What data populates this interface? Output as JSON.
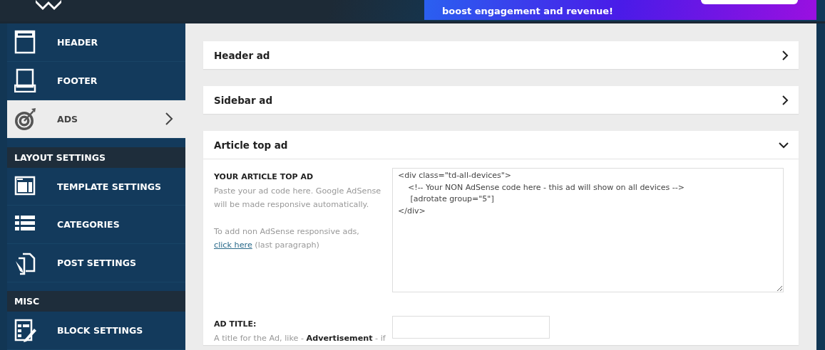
{
  "top_bar": {
    "banner": {
      "text": "boost engagement and revenue!"
    }
  },
  "sidebar": {
    "items": [
      {
        "kind": "item",
        "label": "HEADER",
        "selected": false
      },
      {
        "kind": "item",
        "label": "FOOTER",
        "selected": false
      },
      {
        "kind": "item",
        "label": "ADS",
        "selected": true
      },
      {
        "kind": "section",
        "label": "LAYOUT SETTINGS"
      },
      {
        "kind": "item",
        "label": "TEMPLATE SETTINGS",
        "selected": false
      },
      {
        "kind": "item",
        "label": "CATEGORIES",
        "selected": false
      },
      {
        "kind": "item",
        "label": "POST SETTINGS",
        "selected": false
      },
      {
        "kind": "section",
        "label": "MISC"
      },
      {
        "kind": "item",
        "label": "BLOCK SETTINGS",
        "selected": false
      }
    ]
  },
  "panels": [
    {
      "title": "Header ad",
      "expanded": false
    },
    {
      "title": "Sidebar ad",
      "expanded": false
    },
    {
      "title": "Article top ad",
      "expanded": true,
      "fields": [
        {
          "kind": "textarea",
          "label": "YOUR ARTICLE TOP AD",
          "description": [
            "Paste your ad code here. Google AdSense will be made responsive automatically."
          ],
          "note": {
            "before": "To add non AdSense responsive ads, ",
            "link": "click here",
            "after": " (last paragraph)"
          },
          "value": "<div class=\"td-all-devices\">\n    <!-- Your NON AdSense code here - this ad will show on all devices -->\n     [adrotate group=\"5\"]\n</div>"
        },
        {
          "kind": "input",
          "label": "AD TITLE:",
          "description": [
            "A title for the Ad, like - **Advertisement** - if"
          ]
        }
      ]
    }
  ]
}
